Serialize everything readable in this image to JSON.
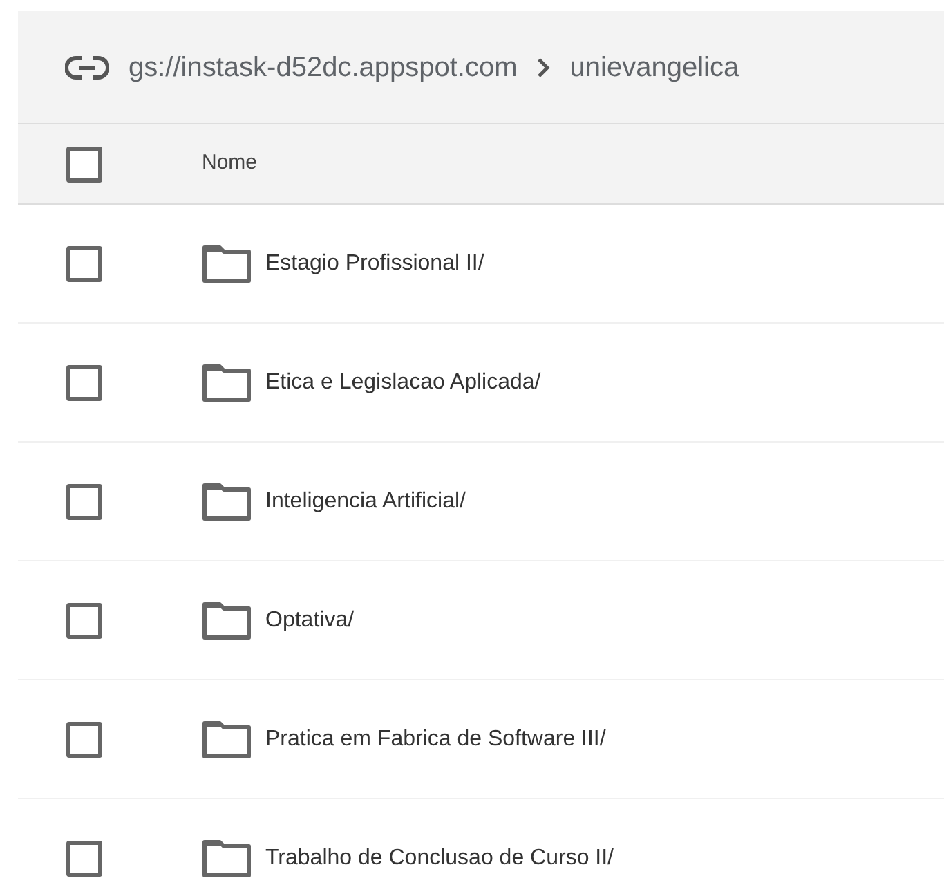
{
  "breadcrumb": [
    {
      "label": "gs://instask-d52dc.appspot.com"
    },
    {
      "label": "unievangelica"
    }
  ],
  "table": {
    "select_all": {
      "checked": false
    },
    "columns": [
      "Nome"
    ],
    "rows": [
      {
        "name": "Estagio Profissional II/",
        "kind": "folder",
        "checked": false
      },
      {
        "name": "Etica e Legislacao Aplicada/",
        "kind": "folder",
        "checked": false
      },
      {
        "name": "Inteligencia Artificial/",
        "kind": "folder",
        "checked": false
      },
      {
        "name": "Optativa/",
        "kind": "folder",
        "checked": false
      },
      {
        "name": "Pratica em Fabrica de Software III/",
        "kind": "folder",
        "checked": false
      },
      {
        "name": "Trabalho de Conclusao de Curso II/",
        "kind": "folder",
        "checked": false
      }
    ]
  }
}
